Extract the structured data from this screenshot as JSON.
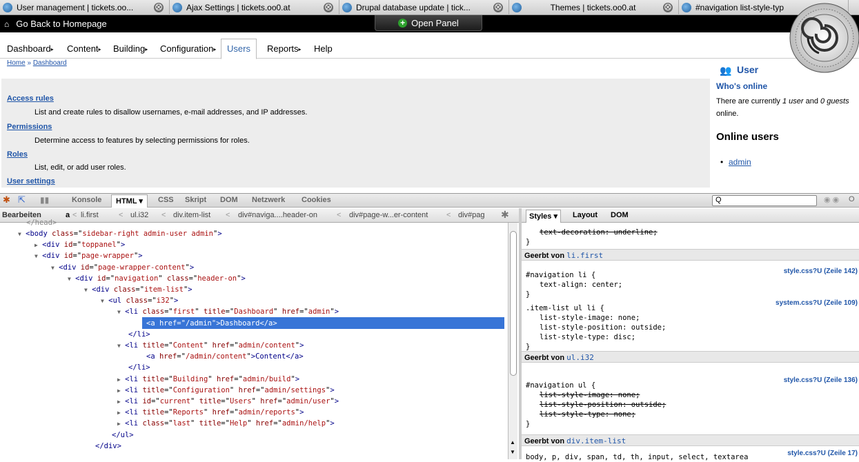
{
  "browser_tabs": [
    {
      "title": "User management | tickets.oo...",
      "close": "⨂"
    },
    {
      "title": "Ajax Settings | tickets.oo0.at",
      "close": "⨂"
    },
    {
      "title": "Drupal database update | tick...",
      "close": "⨂"
    },
    {
      "title": "Themes | tickets.oo0.at",
      "close": "⨂"
    },
    {
      "title": "#navigation list-style-typ",
      "close": ""
    }
  ],
  "topbar": {
    "back_label": "Go Back to Homepage",
    "open_panel_label": "Open Panel"
  },
  "nav": {
    "items": [
      "Dashboard",
      "Content",
      "Building",
      "Configuration",
      "Users",
      "Reports",
      "Help"
    ],
    "arrow": "▸"
  },
  "breadcrumb": {
    "home": "Home",
    "sep": "»",
    "current": "Dashboard"
  },
  "entries": [
    {
      "link": "Access rules",
      "desc": "List and create rules to disallow usernames, e-mail addresses, and IP addresses."
    },
    {
      "link": "Permissions",
      "desc": "Determine access to features by selecting permissions for roles."
    },
    {
      "link": "Roles",
      "desc": "List, edit, or add user roles."
    },
    {
      "link": "User settings",
      "desc": ""
    }
  ],
  "sidebar": {
    "title": "User",
    "whos_online_title": "Who's online",
    "whos_online_prefix": "There are currently ",
    "whos_online_users": "1 user",
    "whos_online_mid": " and ",
    "whos_online_guests": "0 guests",
    "whos_online_suffix": " online.",
    "online_users_title": "Online users",
    "online_user": "admin"
  },
  "firebug": {
    "tabs": [
      "Konsole",
      "HTML",
      "CSS",
      "Skript",
      "DOM",
      "Netzwerk",
      "Cookies"
    ],
    "selected_tab": "HTML",
    "search_placeholder": "Q",
    "edit_label": "Bearbeiten",
    "path": [
      "a",
      "li.first",
      "ul.i32",
      "div.item-list",
      "div#naviga....header-on",
      "div#page-w...er-content",
      "div#pag"
    ],
    "side_tabs": [
      "Styles",
      "Layout",
      "DOM"
    ]
  },
  "html_tree": [
    {
      "indent": 38,
      "twisty": "▼",
      "tag": "<body",
      "attrs": [
        [
          "class",
          "sidebar-right admin-user admin"
        ]
      ],
      "close": ">"
    },
    {
      "indent": 62,
      "twisty": "▶",
      "tag": "<div",
      "attrs": [
        [
          "id",
          "toppanel"
        ]
      ],
      "close": ">"
    },
    {
      "indent": 62,
      "twisty": "▼",
      "tag": "<div",
      "attrs": [
        [
          "id",
          "page-wrapper"
        ]
      ],
      "close": ">"
    },
    {
      "indent": 86,
      "twisty": "▼",
      "tag": "<div",
      "attrs": [
        [
          "id",
          "page-wrapper-content"
        ]
      ],
      "close": ">"
    },
    {
      "indent": 110,
      "twisty": "▼",
      "tag": "<div",
      "attrs": [
        [
          "id",
          "navigation"
        ],
        [
          "class",
          "header-on"
        ]
      ],
      "close": ">"
    },
    {
      "indent": 134,
      "twisty": "▼",
      "tag": "<div",
      "attrs": [
        [
          "class",
          "item-list"
        ]
      ],
      "close": ">"
    },
    {
      "indent": 158,
      "twisty": "▼",
      "tag": "<ul",
      "attrs": [
        [
          "class",
          "i32"
        ]
      ],
      "close": ">"
    },
    {
      "indent": 182,
      "twisty": "▼",
      "tag": "<li",
      "attrs": [
        [
          "class",
          "first"
        ],
        [
          "title",
          "Dashboard"
        ],
        [
          "href",
          "admin"
        ]
      ],
      "close": ">"
    },
    {
      "indent": 212,
      "twisty": "",
      "tag": "<a",
      "attrs": [
        [
          "href",
          "/admin"
        ]
      ],
      "close": ">Dashboard</a>",
      "selected": true
    },
    {
      "indent": 186,
      "twisty": "",
      "tag": "</li>",
      "attrs": [],
      "close": ""
    },
    {
      "indent": 182,
      "twisty": "▼",
      "tag": "<li",
      "attrs": [
        [
          "title",
          "Content"
        ],
        [
          "href",
          "admin/content"
        ]
      ],
      "close": ">"
    },
    {
      "indent": 212,
      "twisty": "",
      "tag": "<a",
      "attrs": [
        [
          "href",
          "/admin/content"
        ]
      ],
      "close": ">Content</a>"
    },
    {
      "indent": 186,
      "twisty": "",
      "tag": "</li>",
      "attrs": [],
      "close": ""
    },
    {
      "indent": 182,
      "twisty": "▶",
      "tag": "<li",
      "attrs": [
        [
          "title",
          "Building"
        ],
        [
          "href",
          "admin/build"
        ]
      ],
      "close": ">"
    },
    {
      "indent": 182,
      "twisty": "▶",
      "tag": "<li",
      "attrs": [
        [
          "title",
          "Configuration"
        ],
        [
          "href",
          "admin/settings"
        ]
      ],
      "close": ">"
    },
    {
      "indent": 182,
      "twisty": "▶",
      "tag": "<li",
      "attrs": [
        [
          "id",
          "current"
        ],
        [
          "title",
          "Users"
        ],
        [
          "href",
          "admin/user"
        ]
      ],
      "close": ">"
    },
    {
      "indent": 182,
      "twisty": "▶",
      "tag": "<li",
      "attrs": [
        [
          "title",
          "Reports"
        ],
        [
          "href",
          "admin/reports"
        ]
      ],
      "close": ">"
    },
    {
      "indent": 182,
      "twisty": "▶",
      "tag": "<li",
      "attrs": [
        [
          "class",
          "last"
        ],
        [
          "title",
          "Help"
        ],
        [
          "href",
          "admin/help"
        ]
      ],
      "close": ">"
    },
    {
      "indent": 162,
      "twisty": "",
      "tag": "</ul>",
      "attrs": [],
      "close": ""
    },
    {
      "indent": 138,
      "twisty": "",
      "tag": "</div>",
      "attrs": [],
      "close": ""
    }
  ],
  "styles": {
    "top_rule": "text-decoration: underline;",
    "inherited_1": {
      "label": "Geerbt von",
      "sel": "li.first"
    },
    "rule1": {
      "selector": "#navigation li {",
      "source": "style.css?U (Zeile 142)",
      "props": [
        "text-align: center;"
      ]
    },
    "rule2": {
      "selector": ".item-list ul li {",
      "source": "system.css?U (Zeile 109)",
      "props": [
        "list-style-image: none;",
        "list-style-position: outside;",
        "list-style-type: disc;"
      ]
    },
    "inherited_2": {
      "label": "Geerbt von",
      "sel": "ul.i32"
    },
    "rule3": {
      "selector": "#navigation ul {",
      "source": "style.css?U (Zeile 136)",
      "props": [
        "list-style-image: none;",
        "list-style-position: outside;",
        "list-style-type: none;"
      ]
    },
    "inherited_3": {
      "label": "Geerbt von",
      "sel": "div.item-list"
    },
    "rule4": {
      "selector": "body, p, div, span, td, th, input, select, textarea",
      "source": "style.css?U (Zeile 17)"
    },
    "close_brace": "}"
  }
}
